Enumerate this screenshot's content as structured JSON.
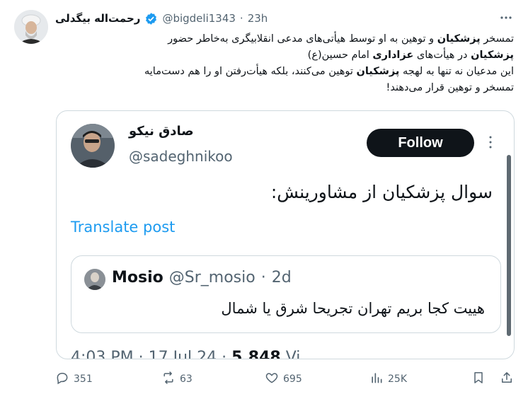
{
  "tweet": {
    "author_name": "رحمت‌اله بیگدلی",
    "handle": "@bigdeli1343",
    "separator": "·",
    "time": "23h",
    "lines": [
      [
        {
          "t": "تمسخر ",
          "b": false
        },
        {
          "t": "پزشکیان",
          "b": true
        },
        {
          "t": " و توهین به او توسط هیأتی‌های مدعی انقلابیگری به‌خاطر حضور",
          "b": false
        }
      ],
      [
        {
          "t": "پزشکیان",
          "b": true
        },
        {
          "t": " در هیأت‌های ",
          "b": false
        },
        {
          "t": "عزاداری",
          "b": true
        },
        {
          "t": " امام حسین(ع)",
          "b": false
        }
      ],
      [
        {
          "t": "این مدعیان نه تنها به لهجه ",
          "b": false
        },
        {
          "t": "پزشکیان",
          "b": true
        },
        {
          "t": " توهین می‌کنند، بلکه هیأت‌رفتن او را هم دست‌مایه",
          "b": false
        }
      ],
      [
        {
          "t": "تمسخر و توهین قرار می‌دهند!",
          "b": false
        }
      ]
    ]
  },
  "embed": {
    "name": "صادق نیکو",
    "handle": "@sadeghnikoo",
    "follow_label": "Follow",
    "text": "سوال پزشکیان از مشاورینش:",
    "translate_label": "Translate post",
    "quote": {
      "name": "Mosio",
      "handle": "@Sr_mosio",
      "separator": "·",
      "time": "2d",
      "text": "هییت کجا بریم تهران تجریحا شرق یا شمال"
    },
    "timestamp": "4:03 PM · 17 Jul 24 · ",
    "views": "5,848",
    "views_label": " Vi"
  },
  "actions": {
    "replies": "351",
    "reposts": "63",
    "likes": "695",
    "views": "25K"
  },
  "colors": {
    "accent": "#1d9bf0",
    "text": "#0f1419",
    "muted": "#536471",
    "border": "#cfd9de"
  }
}
